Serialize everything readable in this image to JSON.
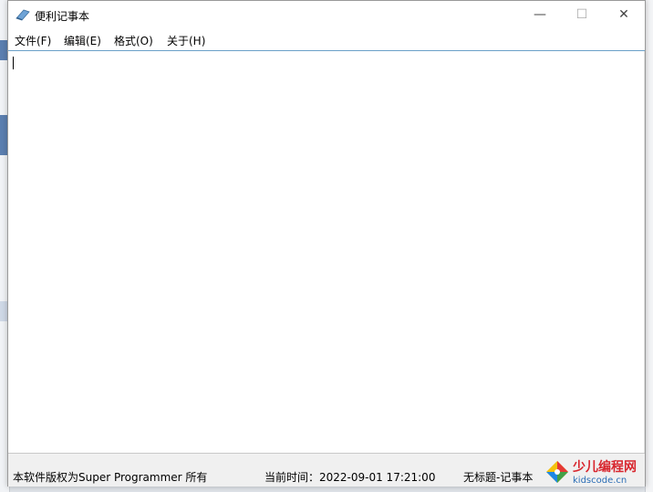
{
  "window": {
    "title": "便利记事本",
    "controls": {
      "minimize": "—",
      "maximize": "☐",
      "close": "✕"
    }
  },
  "menu": {
    "items": [
      {
        "label": "文件(F)"
      },
      {
        "label": "编辑(E)"
      },
      {
        "label": "格式(O)"
      },
      {
        "label": "关于(H)"
      }
    ]
  },
  "editor": {
    "content": ""
  },
  "status": {
    "copyright": "本软件版权为Super Programmer 所有",
    "time": "当前时间：2022-09-01 17:21:00",
    "doc_title": "无标题-记事本"
  },
  "watermark": {
    "line1": "少儿编程网",
    "line2": "kidscode.cn"
  },
  "colors": {
    "menu_border": "#6aa0c8",
    "watermark_red": "#d8262e",
    "watermark_blue": "#2a6db5"
  }
}
